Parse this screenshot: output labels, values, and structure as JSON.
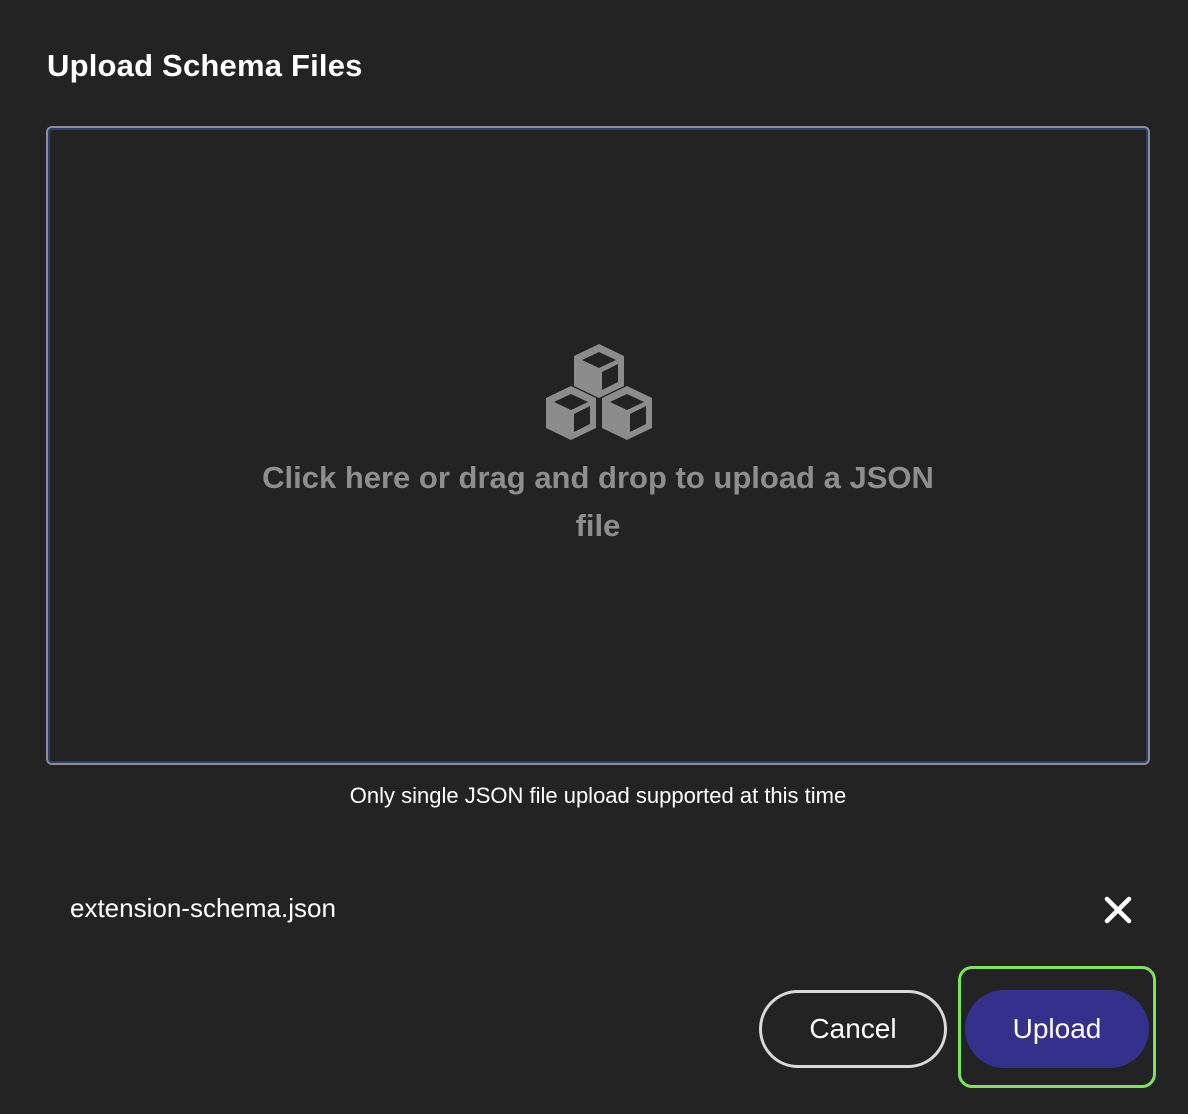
{
  "dialog": {
    "title": "Upload Schema Files"
  },
  "dropzone": {
    "icon": "cubes-icon",
    "prompt": "Click here or drag and drop to upload a JSON file",
    "hint": "Only single JSON file upload supported at this time"
  },
  "file": {
    "name": "extension-schema.json",
    "remove_icon": "close-icon"
  },
  "actions": {
    "cancel_label": "Cancel",
    "upload_label": "Upload"
  },
  "colors": {
    "background": "#232323",
    "upload_button": "#34318c",
    "focus_ring": "#7de35a",
    "muted_text": "#8e8e8e"
  }
}
